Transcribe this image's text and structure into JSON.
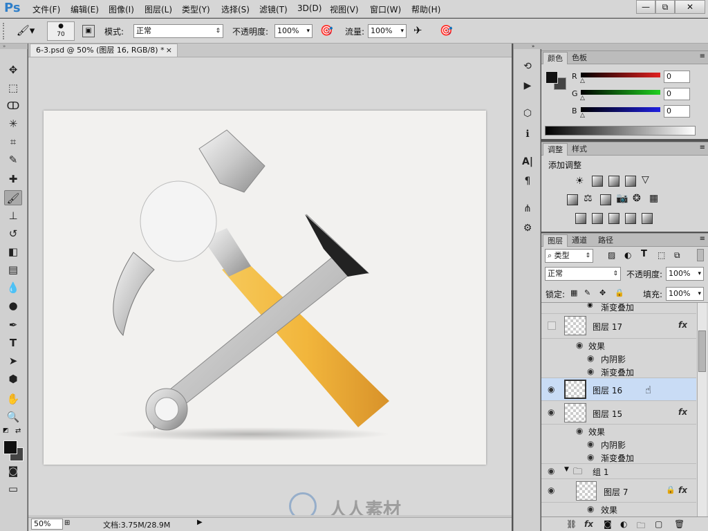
{
  "app": {
    "logo": "Ps"
  },
  "menu": [
    "文件(F)",
    "编辑(E)",
    "图像(I)",
    "图层(L)",
    "类型(Y)",
    "选择(S)",
    "滤镜(T)",
    "3D(D)",
    "视图(V)",
    "窗口(W)",
    "帮助(H)"
  ],
  "window_buttons": {
    "minimize": "—",
    "restore": "⧉",
    "close": "✕"
  },
  "options": {
    "brush_size": "70",
    "mode_label": "模式:",
    "mode_value": "正常",
    "opacity_label": "不透明度:",
    "opacity_value": "100%",
    "flow_label": "流量:",
    "flow_value": "100%"
  },
  "document": {
    "tab_title": "6-3.psd @ 50% (图层 16, RGB/8) *",
    "close": "×"
  },
  "status": {
    "zoom": "50%",
    "doc_info": "文档:3.75M/28.9M"
  },
  "color_panel": {
    "tabs": [
      "颜色",
      "色板"
    ],
    "channels": [
      {
        "name": "R",
        "value": "0"
      },
      {
        "name": "G",
        "value": "0"
      },
      {
        "name": "B",
        "value": "0"
      }
    ]
  },
  "adjust_panel": {
    "tabs": [
      "调整",
      "样式"
    ],
    "title": "添加调整"
  },
  "layers_panel": {
    "tabs": [
      "图层",
      "通道",
      "路径"
    ],
    "filter_kind": "类型",
    "blend_mode": "正常",
    "opacity_label": "不透明度:",
    "opacity_value": "100%",
    "lock_label": "锁定:",
    "fill_label": "填充:",
    "fill_value": "100%",
    "rows": {
      "partial_effect": "渐变叠加",
      "layer17": "图层 17",
      "effects1": "效果",
      "inner_shadow1": "内阴影",
      "gradient1": "渐变叠加",
      "layer16": "图层 16",
      "layer15": "图层 15",
      "effects2": "效果",
      "inner_shadow2": "内阴影",
      "gradient2": "渐变叠加",
      "group1": "组 1",
      "layer7": "图层 7",
      "effects3": "效果"
    }
  },
  "watermark": "人人素材",
  "colors": {
    "accent": "#2f7fc9",
    "selected_row": "#c9dcf5",
    "handle": "#f2b63c"
  }
}
